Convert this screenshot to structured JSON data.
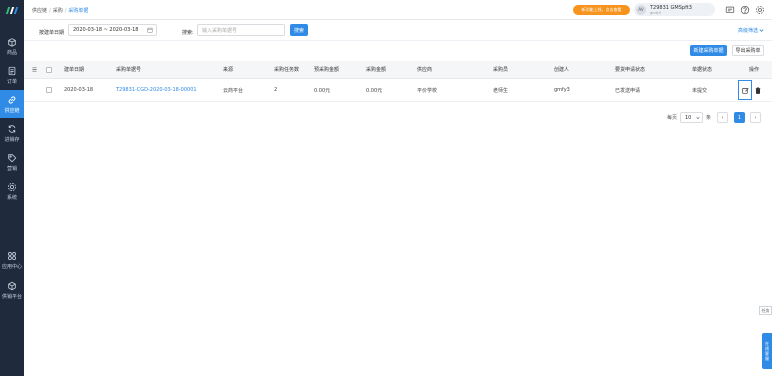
{
  "colors": {
    "accent": "#2f8be6",
    "sidebar": "#1f2a3c",
    "promo": "#f7941d",
    "logo_bars": [
      "#2fbf71",
      "#ffffff",
      "#2f8be6"
    ]
  },
  "sidebar": {
    "items": [
      {
        "label": "商品",
        "icon": "box-icon"
      },
      {
        "label": "订单",
        "icon": "document-icon"
      },
      {
        "label": "供应链",
        "icon": "link-icon",
        "active": true
      },
      {
        "label": "进销存",
        "icon": "refresh-icon"
      },
      {
        "label": "营销",
        "icon": "tag-icon"
      },
      {
        "label": "系统",
        "icon": "gear-icon"
      },
      {
        "label": "应用中心",
        "icon": "apps-icon"
      },
      {
        "label": "供销平台",
        "icon": "cube-icon"
      }
    ]
  },
  "topbar": {
    "breadcrumb": [
      "供应链",
      "采购",
      "采购单据"
    ],
    "promo": "新功能上线，点击查看",
    "user_name": "T29831 GMSpft3",
    "user_sub": "gmfy3",
    "avatar_text": "AV"
  },
  "filters": {
    "date_label": "按建单日期",
    "date_range": "2020-03-18 ~ 2020-03-18",
    "search_label": "搜索:",
    "search_placeholder": "输入采购单据号",
    "search_button": "搜索",
    "advanced": "高级筛选",
    "new_button": "新建采购单据",
    "export_button": "导出采购单"
  },
  "table": {
    "columns": [
      "建单日期",
      "采购单据号",
      "来源",
      "采购任务数",
      "预采购金额",
      "采购金额",
      "供应商",
      "采购员",
      "创建人",
      "要货申请状态",
      "单据状态",
      "操作"
    ],
    "rows": [
      {
        "date": "2020-03-18",
        "order_no": "T29831-CGD-2020-03-18-00001",
        "source": "云商平台",
        "task_count": "2",
        "pre_amount": "0.00元",
        "amount": "0.00元",
        "supplier": "平价学校",
        "buyer": "老师生",
        "creator": "gmfy3",
        "request_status": "已发送申请",
        "doc_status": "未提交"
      }
    ]
  },
  "pagination": {
    "per_page_label": "每页",
    "page_size": "10",
    "unit": "条",
    "current_page": "1",
    "prev": "‹",
    "next": "›"
  },
  "floating": {
    "task": "任务",
    "help": [
      "在",
      "线",
      "客",
      "服"
    ]
  }
}
